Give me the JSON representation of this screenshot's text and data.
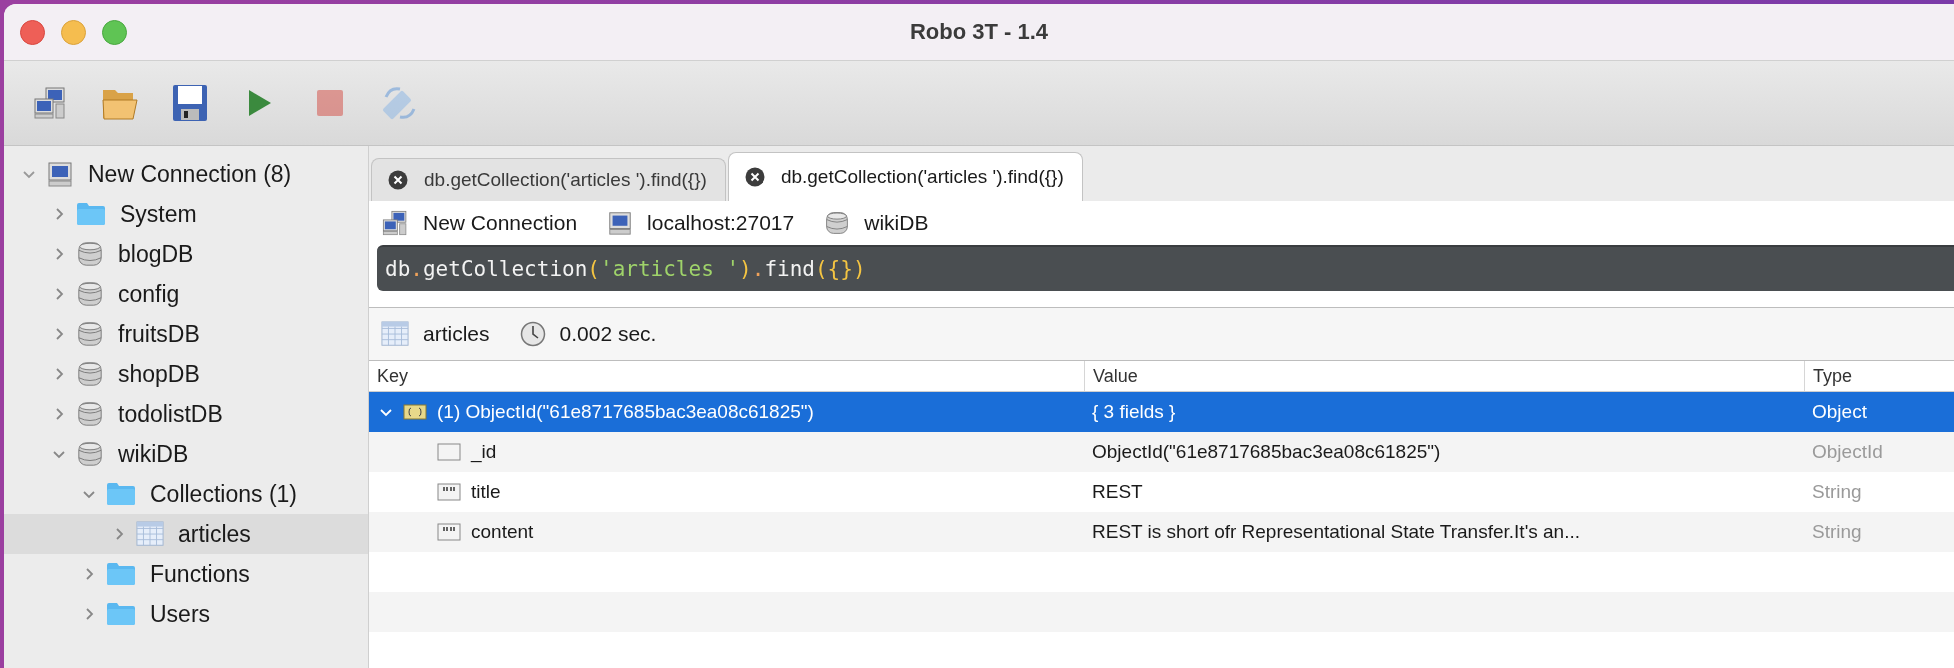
{
  "window": {
    "title": "Robo 3T - 1.4"
  },
  "toolbar": [
    {
      "kind": "connect",
      "disabled": false
    },
    {
      "kind": "open",
      "disabled": false
    },
    {
      "kind": "save",
      "disabled": false
    },
    {
      "kind": "run",
      "disabled": false
    },
    {
      "kind": "stop",
      "disabled": true
    },
    {
      "kind": "rotate",
      "disabled": true
    }
  ],
  "tree": [
    {
      "label": "New Connection (8)",
      "kind": "connection",
      "expanded": true,
      "selected": false,
      "children": [
        {
          "label": "System",
          "kind": "folder",
          "expanded": false,
          "selected": false
        },
        {
          "label": "blogDB",
          "kind": "database",
          "expanded": false,
          "selected": false
        },
        {
          "label": "config",
          "kind": "database",
          "expanded": false,
          "selected": false
        },
        {
          "label": "fruitsDB",
          "kind": "database",
          "expanded": false,
          "selected": false
        },
        {
          "label": "shopDB",
          "kind": "database",
          "expanded": false,
          "selected": false
        },
        {
          "label": "todolistDB",
          "kind": "database",
          "expanded": false,
          "selected": false
        },
        {
          "label": "wikiDB",
          "kind": "database",
          "expanded": true,
          "selected": false,
          "children": [
            {
              "label": "Collections (1)",
              "kind": "folder",
              "expanded": true,
              "selected": false,
              "children": [
                {
                  "label": "articles",
                  "kind": "collection",
                  "expanded": false,
                  "selected": true
                }
              ]
            },
            {
              "label": "Functions",
              "kind": "folder",
              "expanded": false,
              "selected": false
            },
            {
              "label": "Users",
              "kind": "folder",
              "expanded": false,
              "selected": false
            }
          ]
        }
      ]
    }
  ],
  "tabs": [
    {
      "label": "db.getCollection('articles ').find({})",
      "selected": false
    },
    {
      "label": "db.getCollection('articles ').find({})",
      "selected": true
    }
  ],
  "connection_bar": {
    "connection": "New Connection",
    "host": "localhost:27017",
    "database": "wikiDB"
  },
  "query": {
    "tokens": [
      {
        "text": "db",
        "kind": "ident"
      },
      {
        "text": ".",
        "kind": "dot"
      },
      {
        "text": "getCollection",
        "kind": "ident"
      },
      {
        "text": "(",
        "kind": "paren"
      },
      {
        "text": "'articles '",
        "kind": "string"
      },
      {
        "text": ")",
        "kind": "paren"
      },
      {
        "text": ".",
        "kind": "dot"
      },
      {
        "text": "find",
        "kind": "ident"
      },
      {
        "text": "({})",
        "kind": "paren"
      }
    ]
  },
  "results": {
    "collection": "articles",
    "time": "0.002 sec."
  },
  "table": {
    "columns": [
      "Key",
      "Value",
      "Type"
    ],
    "rows": [
      {
        "key": "(1) ObjectId(\"61e8717685bac3ea08c61825\")",
        "value": "{ 3 fields }",
        "type": "Object",
        "kind": "object",
        "expanded": true,
        "selected": true,
        "children": [
          {
            "key": "_id",
            "value": "ObjectId(\"61e8717685bac3ea08c61825\")",
            "type": "ObjectId",
            "kind": "objectid",
            "selected": false
          },
          {
            "key": "title",
            "value": "REST",
            "type": "String",
            "kind": "string",
            "selected": false
          },
          {
            "key": "content",
            "value": "REST is short ofr Representational State Transfer.It's an...",
            "type": "String",
            "kind": "string",
            "selected": false
          }
        ]
      }
    ]
  }
}
